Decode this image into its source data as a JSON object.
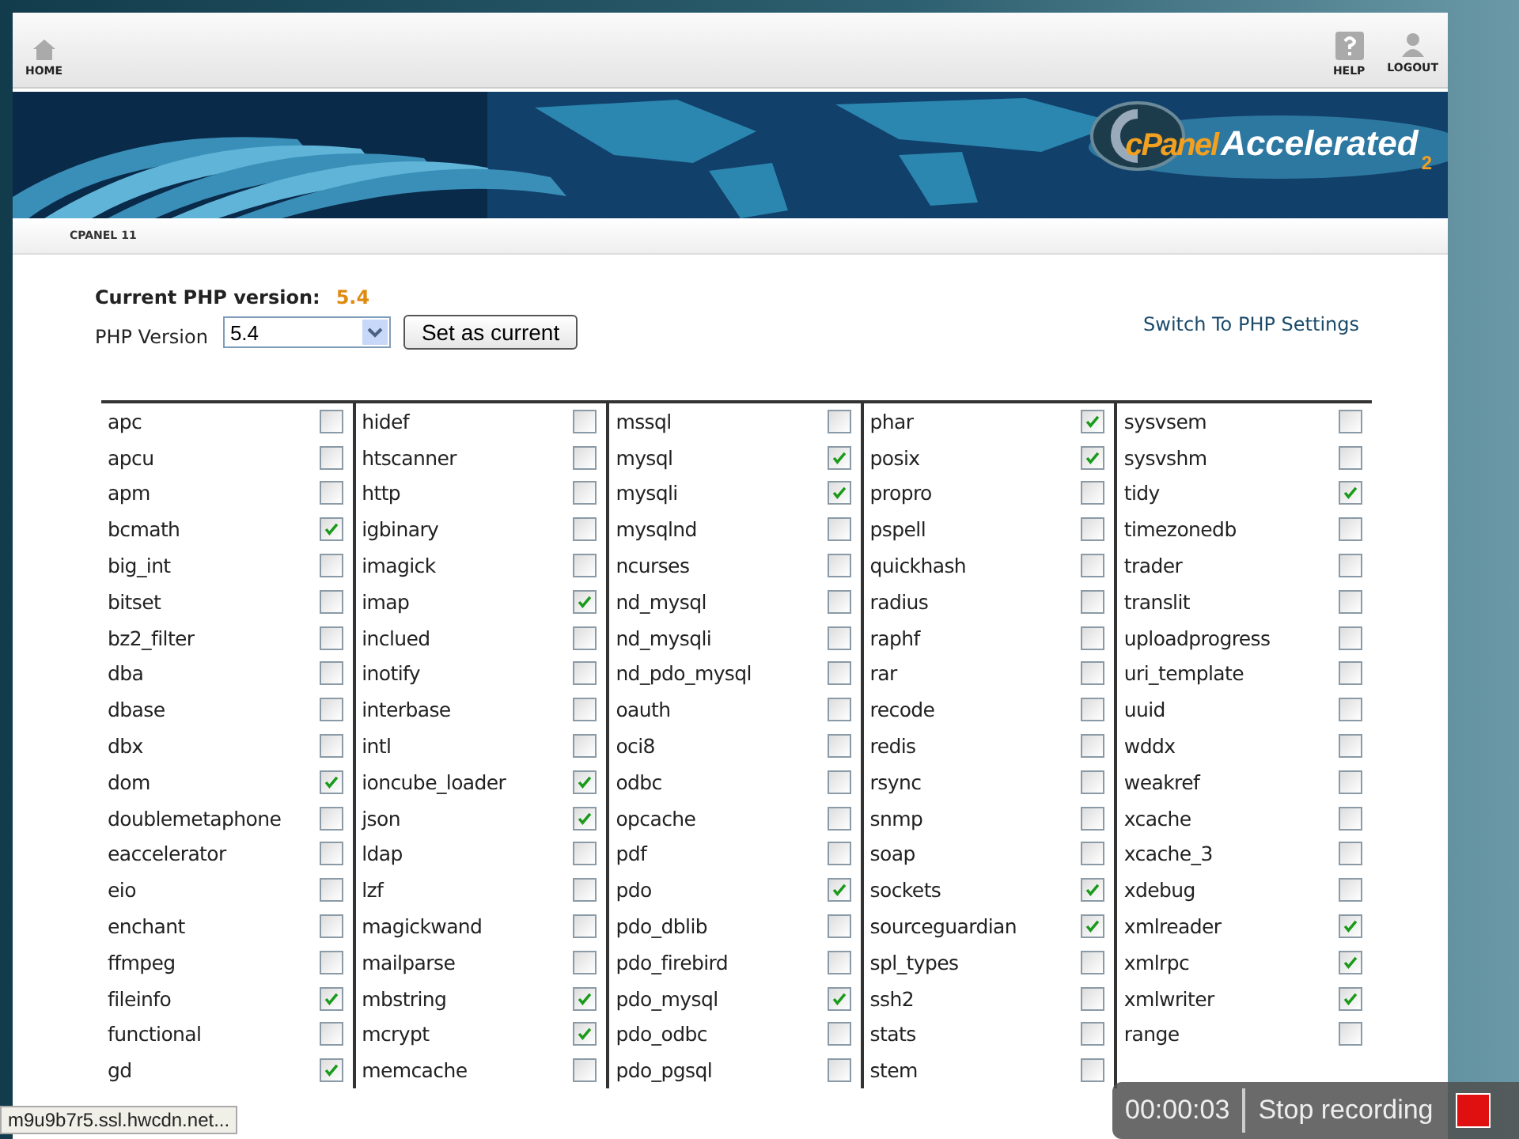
{
  "header": {
    "home": "HOME",
    "help": "HELP",
    "logout": "LOGOUT"
  },
  "banner": {
    "brand": "cPanel",
    "product": "Accelerated",
    "version": "2"
  },
  "breadcrumb": "CPANEL 11",
  "current": {
    "label": "Current PHP version:",
    "value": "5.4"
  },
  "version_select": {
    "label": "PHP Version",
    "value": "5.4"
  },
  "set_button": "Set as current",
  "switch_link": "Switch To PHP Settings",
  "columns": [
    {
      "items": [
        {
          "name": "apc",
          "checked": false
        },
        {
          "name": "apcu",
          "checked": false
        },
        {
          "name": "apm",
          "checked": false
        },
        {
          "name": "bcmath",
          "checked": true
        },
        {
          "name": "big_int",
          "checked": false
        },
        {
          "name": "bitset",
          "checked": false
        },
        {
          "name": "bz2_filter",
          "checked": false
        },
        {
          "name": "dba",
          "checked": false
        },
        {
          "name": "dbase",
          "checked": false
        },
        {
          "name": "dbx",
          "checked": false
        },
        {
          "name": "dom",
          "checked": true
        },
        {
          "name": "doublemetaphone",
          "checked": false
        },
        {
          "name": "eaccelerator",
          "checked": false
        },
        {
          "name": "eio",
          "checked": false
        },
        {
          "name": "enchant",
          "checked": false
        },
        {
          "name": "ffmpeg",
          "checked": false
        },
        {
          "name": "fileinfo",
          "checked": true
        },
        {
          "name": "functional",
          "checked": false
        },
        {
          "name": "gd",
          "checked": true
        }
      ]
    },
    {
      "items": [
        {
          "name": "hidef",
          "checked": false
        },
        {
          "name": "htscanner",
          "checked": false
        },
        {
          "name": "http",
          "checked": false
        },
        {
          "name": "igbinary",
          "checked": false
        },
        {
          "name": "imagick",
          "checked": false
        },
        {
          "name": "imap",
          "checked": true
        },
        {
          "name": "inclued",
          "checked": false
        },
        {
          "name": "inotify",
          "checked": false
        },
        {
          "name": "interbase",
          "checked": false
        },
        {
          "name": "intl",
          "checked": false
        },
        {
          "name": "ioncube_loader",
          "checked": true
        },
        {
          "name": "json",
          "checked": true
        },
        {
          "name": "ldap",
          "checked": false
        },
        {
          "name": "lzf",
          "checked": false
        },
        {
          "name": "magickwand",
          "checked": false
        },
        {
          "name": "mailparse",
          "checked": false
        },
        {
          "name": "mbstring",
          "checked": true
        },
        {
          "name": "mcrypt",
          "checked": true
        },
        {
          "name": "memcache",
          "checked": false
        }
      ]
    },
    {
      "items": [
        {
          "name": "mssql",
          "checked": false
        },
        {
          "name": "mysql",
          "checked": true
        },
        {
          "name": "mysqli",
          "checked": true
        },
        {
          "name": "mysqlnd",
          "checked": false
        },
        {
          "name": "ncurses",
          "checked": false
        },
        {
          "name": "nd_mysql",
          "checked": false
        },
        {
          "name": "nd_mysqli",
          "checked": false
        },
        {
          "name": "nd_pdo_mysql",
          "checked": false
        },
        {
          "name": "oauth",
          "checked": false
        },
        {
          "name": "oci8",
          "checked": false
        },
        {
          "name": "odbc",
          "checked": false
        },
        {
          "name": "opcache",
          "checked": false
        },
        {
          "name": "pdf",
          "checked": false
        },
        {
          "name": "pdo",
          "checked": true
        },
        {
          "name": "pdo_dblib",
          "checked": false
        },
        {
          "name": "pdo_firebird",
          "checked": false
        },
        {
          "name": "pdo_mysql",
          "checked": true
        },
        {
          "name": "pdo_odbc",
          "checked": false
        },
        {
          "name": "pdo_pgsql",
          "checked": false
        }
      ]
    },
    {
      "items": [
        {
          "name": "phar",
          "checked": true
        },
        {
          "name": "posix",
          "checked": true
        },
        {
          "name": "propro",
          "checked": false
        },
        {
          "name": "pspell",
          "checked": false
        },
        {
          "name": "quickhash",
          "checked": false
        },
        {
          "name": "radius",
          "checked": false
        },
        {
          "name": "raphf",
          "checked": false
        },
        {
          "name": "rar",
          "checked": false
        },
        {
          "name": "recode",
          "checked": false
        },
        {
          "name": "redis",
          "checked": false
        },
        {
          "name": "rsync",
          "checked": false
        },
        {
          "name": "snmp",
          "checked": false
        },
        {
          "name": "soap",
          "checked": false
        },
        {
          "name": "sockets",
          "checked": true
        },
        {
          "name": "sourceguardian",
          "checked": true
        },
        {
          "name": "spl_types",
          "checked": false
        },
        {
          "name": "ssh2",
          "checked": false
        },
        {
          "name": "stats",
          "checked": false
        },
        {
          "name": "stem",
          "checked": false
        }
      ]
    },
    {
      "items": [
        {
          "name": "sysvsem",
          "checked": false
        },
        {
          "name": "sysvshm",
          "checked": false
        },
        {
          "name": "tidy",
          "checked": true
        },
        {
          "name": "timezonedb",
          "checked": false
        },
        {
          "name": "trader",
          "checked": false
        },
        {
          "name": "translit",
          "checked": false
        },
        {
          "name": "uploadprogress",
          "checked": false
        },
        {
          "name": "uri_template",
          "checked": false
        },
        {
          "name": "uuid",
          "checked": false
        },
        {
          "name": "wddx",
          "checked": false
        },
        {
          "name": "weakref",
          "checked": false
        },
        {
          "name": "xcache",
          "checked": false
        },
        {
          "name": "xcache_3",
          "checked": false
        },
        {
          "name": "xdebug",
          "checked": false
        },
        {
          "name": "xmlreader",
          "checked": true
        },
        {
          "name": "xmlrpc",
          "checked": true
        },
        {
          "name": "xmlwriter",
          "checked": true
        },
        {
          "name": "range",
          "checked": false
        }
      ]
    }
  ],
  "status_url": "m9u9b7r5.ssl.hwcdn.net...",
  "recorder": {
    "time": "00:00:03",
    "stop": "Stop recording"
  }
}
